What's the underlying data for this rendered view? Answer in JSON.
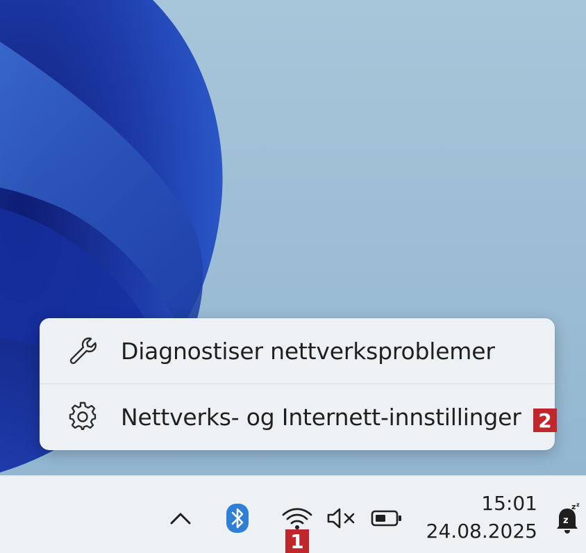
{
  "context_menu": {
    "items": [
      {
        "label": "Diagnostiser nettverksproblemer",
        "icon": "wrench-icon"
      },
      {
        "label": "Nettverks- og Internett-innstillinger",
        "icon": "gear-icon"
      }
    ]
  },
  "callouts": {
    "first": "1",
    "second": "2"
  },
  "taskbar": {
    "tray_icons": [
      "chevron-up-icon",
      "bluetooth-icon",
      "wifi-icon",
      "volume-muted-icon",
      "battery-icon",
      "notification-bell-snooze-icon"
    ],
    "clock": {
      "time": "15:01",
      "date": "24.08.2025"
    }
  },
  "colors": {
    "callout": "#c0272d",
    "bluetooth": "#2f7fd6",
    "menu_bg": "#eef1f4",
    "desktop": "#a8c6da"
  }
}
